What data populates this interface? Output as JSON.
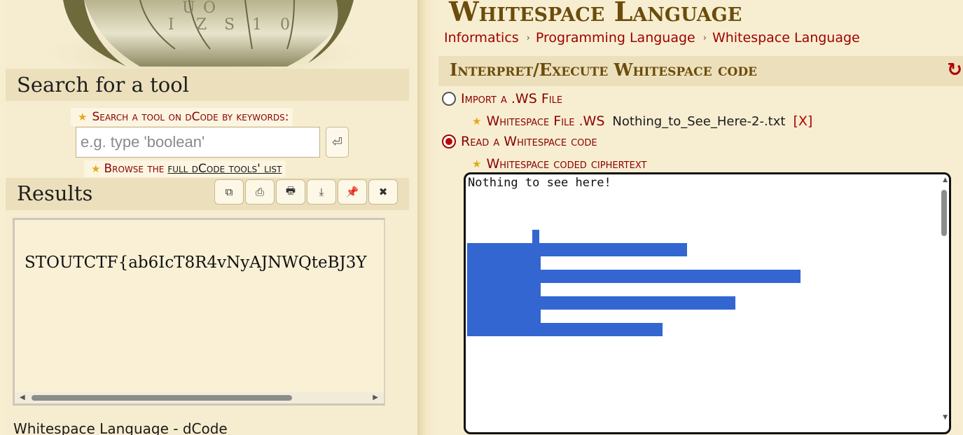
{
  "page": {
    "title": "Whitespace Language",
    "breadcrumb": [
      "Informatics",
      "Programming Language",
      "Whitespace Language"
    ]
  },
  "sidebar": {
    "search_title": "Search for a tool",
    "keywords_label": "Search a tool on dCode by keywords:",
    "search_placeholder": "e.g. type 'boolean'",
    "search_go_icon": "enter-icon",
    "browse_prefix": "Browse the",
    "browse_link": "full dCode tools' list",
    "results_title": "Results",
    "result_tools": [
      {
        "name": "copy",
        "icon": "copy-icon",
        "glyph": "⧉"
      },
      {
        "name": "share",
        "icon": "share-icon",
        "glyph": "⎙"
      },
      {
        "name": "print",
        "icon": "print-icon",
        "glyph": "🖶"
      },
      {
        "name": "download",
        "icon": "download-icon",
        "glyph": "⤓"
      },
      {
        "name": "pin",
        "icon": "pin-icon",
        "glyph": "📌"
      },
      {
        "name": "close",
        "icon": "close-icon",
        "glyph": "✖"
      }
    ],
    "result_text": "STOUTCTF{ab6IcT8R4vNyAJNWQteBJ3Y",
    "footer_link": "Whitespace Language - dCode"
  },
  "tool": {
    "title": "Interpret/Execute Whitespace code",
    "refresh_icon": "refresh-icon",
    "option_import": "Import a .WS File",
    "file_label": "Whitespace File .WS",
    "file_name": "Nothing_to_See_Here-2-.txt",
    "file_clear": "[X]",
    "option_read": "Read a Whitespace code",
    "ciphertext_label": "Whitespace coded ciphertext",
    "ciphertext": "Nothing to see here!"
  },
  "colors": {
    "accent": "#8b0000",
    "title": "#6b4c0b",
    "selection": "#3366d1",
    "background": "#f7eed2"
  }
}
